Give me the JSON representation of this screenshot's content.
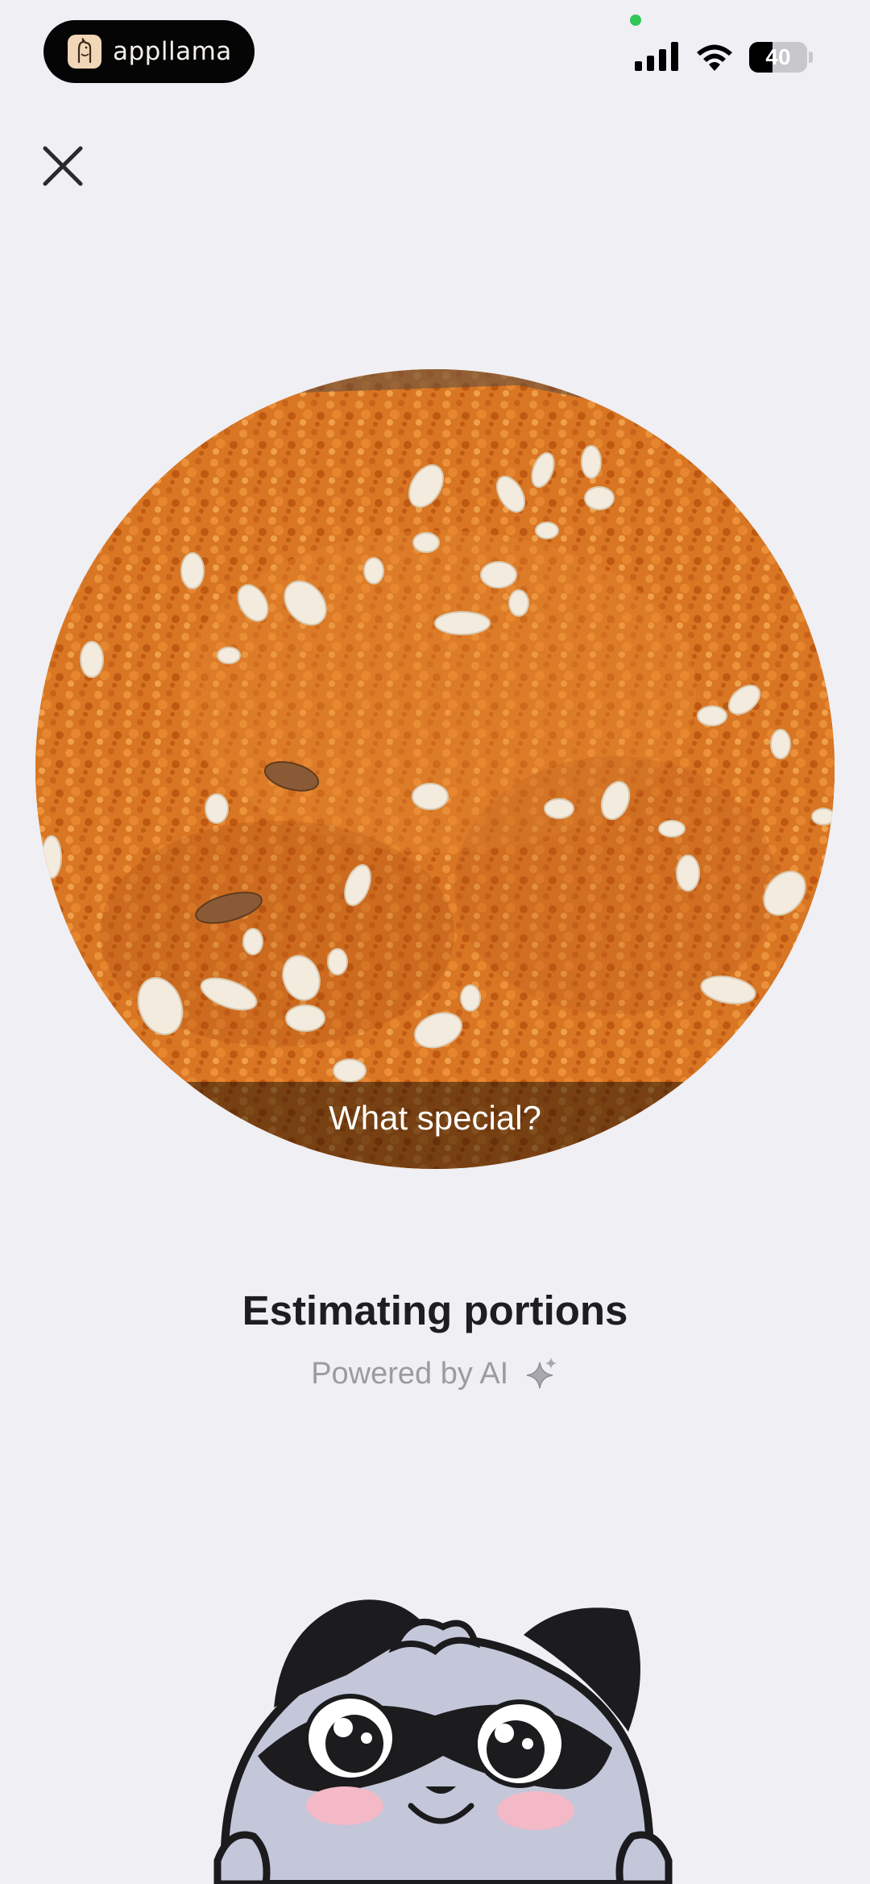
{
  "status_bar": {
    "app_name": "appllama",
    "battery_level": "40",
    "battery_fraction": 0.4,
    "icons": [
      "llama-logo-icon",
      "signal-icon",
      "wifi-icon",
      "battery-icon"
    ]
  },
  "nav": {
    "close_icon": "close-icon"
  },
  "photo": {
    "caption": "What special?",
    "subject": "carrot-halwa-photo"
  },
  "status": {
    "title": "Estimating portions",
    "subtitle": "Powered by AI",
    "subtitle_icon": "sparkle-icon"
  },
  "mascot": {
    "icon": "raccoon-mascot-icon"
  },
  "colors": {
    "background": "#efeff4",
    "title": "#1d1d22",
    "subtitle": "#9b9ba0",
    "pill": "#050505",
    "recording_dot": "#32c759"
  }
}
